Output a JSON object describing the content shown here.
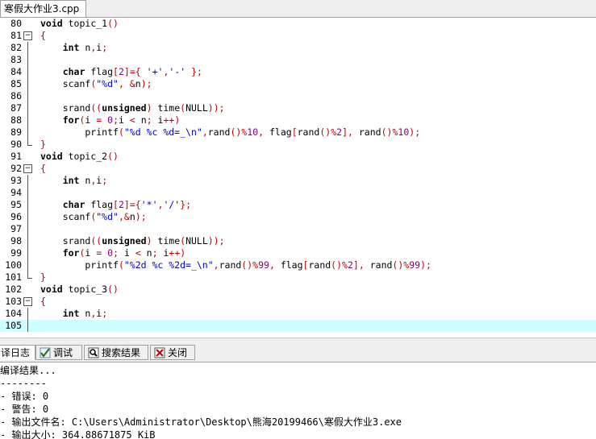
{
  "file_tab": {
    "label": "寒假大作业3.cpp"
  },
  "editor": {
    "lines": [
      {
        "num": "80",
        "code": "void topic_1()"
      },
      {
        "num": "81",
        "code": "{"
      },
      {
        "num": "82",
        "code": "    int n,i;"
      },
      {
        "num": "83",
        "code": ""
      },
      {
        "num": "84",
        "code": "    char flag[2]={ '+','-' };"
      },
      {
        "num": "85",
        "code": "    scanf(\"%d\", &n);"
      },
      {
        "num": "86",
        "code": ""
      },
      {
        "num": "87",
        "code": "    srand((unsigned) time(NULL));"
      },
      {
        "num": "88",
        "code": "    for(i = 0;i < n; i++)"
      },
      {
        "num": "89",
        "code": "        printf(\"%d %c %d=_\\n\",rand()%10, flag[rand()%2], rand()%10);"
      },
      {
        "num": "90",
        "code": "}"
      },
      {
        "num": "91",
        "code": "void topic_2()"
      },
      {
        "num": "92",
        "code": "{"
      },
      {
        "num": "93",
        "code": "    int n,i;"
      },
      {
        "num": "94",
        "code": ""
      },
      {
        "num": "95",
        "code": "    char flag[2]={'*','/'};"
      },
      {
        "num": "96",
        "code": "    scanf(\"%d\",&n);"
      },
      {
        "num": "97",
        "code": ""
      },
      {
        "num": "98",
        "code": "    srand((unsigned) time(NULL));"
      },
      {
        "num": "99",
        "code": "    for(i = 0; i < n; i++)"
      },
      {
        "num": "100",
        "code": "        printf(\"%2d %c %2d=_\\n\",rand()%99, flag[rand()%2], rand()%99);"
      },
      {
        "num": "101",
        "code": "}"
      },
      {
        "num": "102",
        "code": "void topic_3()"
      },
      {
        "num": "103",
        "code": "{"
      },
      {
        "num": "104",
        "code": "    int n,i;"
      },
      {
        "num": "105",
        "code": ""
      }
    ],
    "current_line": "105"
  },
  "bottom_tabs": [
    {
      "label": "译日志",
      "icon": "compile-log-icon"
    },
    {
      "label": "调试",
      "icon": "debug-check-icon"
    },
    {
      "label": "搜索结果",
      "icon": "search-results-icon"
    },
    {
      "label": "关闭",
      "icon": "close-icon"
    }
  ],
  "output": {
    "lines": [
      "编译结果...",
      "--------",
      "- 错误: 0",
      "- 警告: 0",
      "- 输出文件名: C:\\Users\\Administrator\\Desktop\\熊海20199466\\寒假大作业3.exe",
      "- 输出大小: 364.88671875 KiB"
    ]
  },
  "colors": {
    "keyword": "#000000",
    "string": "#0000c0",
    "symbol": "#c00000",
    "number": "#800080",
    "current_line_bg": "#ccffff"
  }
}
